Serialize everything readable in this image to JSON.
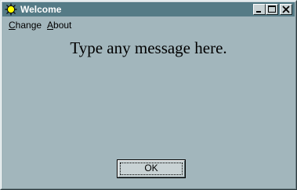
{
  "window": {
    "title": "Welcome",
    "icon": "sun-icon",
    "controls": [
      "minimize-icon",
      "maximize-icon",
      "close-icon"
    ]
  },
  "menu": {
    "items": [
      {
        "label": "Change",
        "mnemonic": "C",
        "rest": "hange"
      },
      {
        "label": "About",
        "mnemonic": "A",
        "rest": "bout"
      }
    ]
  },
  "content": {
    "message": "Type any message here."
  },
  "buttons": {
    "ok_label": "OK"
  }
}
